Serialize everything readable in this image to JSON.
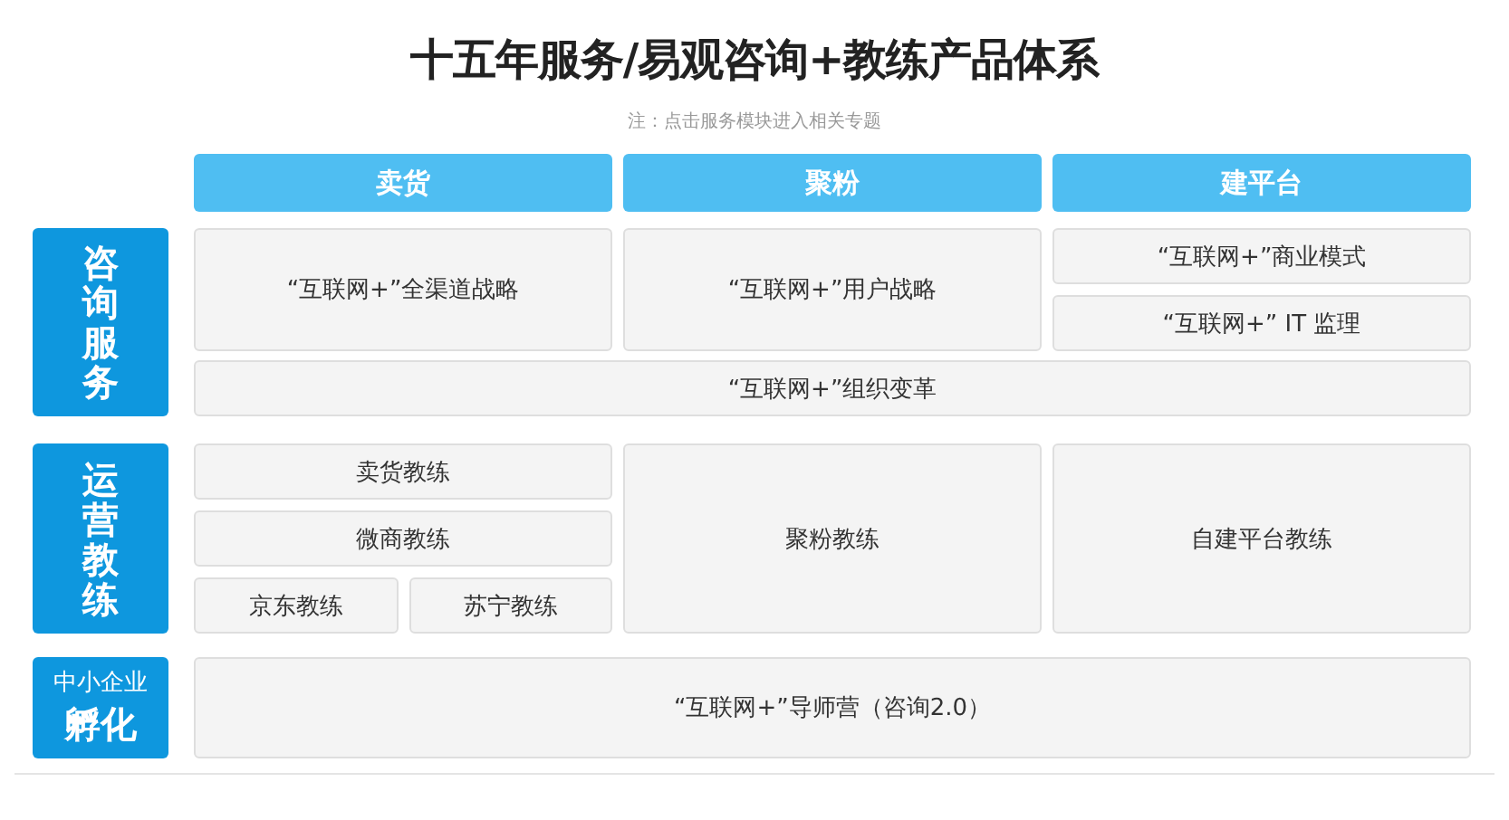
{
  "title": "十五年服务/易观咨询+教练产品体系",
  "note": "注：点击服务模块进入相关专题",
  "columns": [
    "卖货",
    "聚粉",
    "建平台"
  ],
  "sections": [
    {
      "label_parts": [
        {
          "text": "咨询服务",
          "kind": "vertical"
        }
      ],
      "columns": [
        [
          [
            "“互联网+”全渠道战略"
          ]
        ],
        [
          [
            "“互联网+”用户战略"
          ]
        ],
        [
          [
            "“互联网+”商业模式"
          ],
          [
            "“互联网+” IT 监理"
          ]
        ]
      ],
      "wide_rows": [
        [
          "“互联网+”组织变革"
        ]
      ]
    },
    {
      "label_parts": [
        {
          "text": "运营教练",
          "kind": "vertical"
        }
      ],
      "columns": [
        [
          [
            "卖货教练"
          ],
          [
            "微商教练"
          ],
          [
            "京东教练",
            "苏宁教练"
          ]
        ],
        [
          [
            "聚粉教练"
          ]
        ],
        [
          [
            "自建平台教练"
          ]
        ]
      ]
    },
    {
      "label_parts": [
        {
          "text": "中小企业",
          "kind": "small"
        },
        {
          "text": "孵化",
          "kind": "large"
        }
      ],
      "wide_rows": [
        [
          "“互联网+”导师营（咨询2.0）"
        ]
      ]
    }
  ]
}
